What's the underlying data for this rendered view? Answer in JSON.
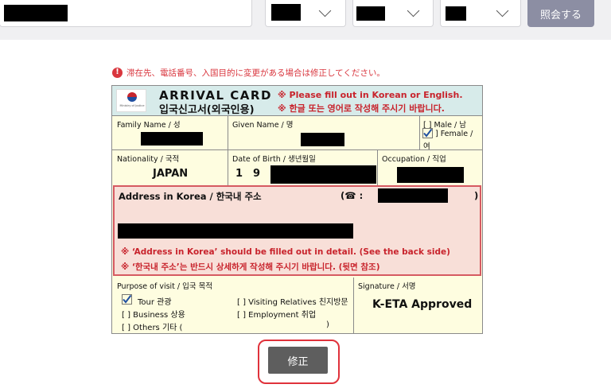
{
  "topbar": {
    "inquiry_button": "照会する"
  },
  "notice": {
    "icon": "exclamation-circle-icon",
    "text": "滞在先、電話番号、入国目的に変更がある場合は修正してください。"
  },
  "card": {
    "logo_caption": "Ministry of Justice",
    "title_en": "ARRIVAL CARD",
    "title_ko": "입국신고서(외국인용)",
    "header_note_en": "※ Please fill out in Korean or English.",
    "header_note_ko": "※ 한글 또는 영어로 작성해 주시기 바랍니다.",
    "family_name_label": "Family Name / 성",
    "given_name_label": "Given Name / 명",
    "sex_male": "[ ] Male / 남",
    "sex_female": "] Female /",
    "sex_female_ko": "여",
    "nationality_label": "Nationality / 국적",
    "nationality_value": "JAPAN",
    "dob_label": "Date of Birth / 생년월일",
    "dob_digits": [
      "1",
      "9"
    ],
    "occupation_label": "Occupation / 직업",
    "address_label": "Address in Korea / 한국내 주소",
    "phone_label": "(☎ :",
    "phone_close": ")",
    "address_note_en": "※ ‘Address in Korea’ should be filled out in detail. (See the back side)",
    "address_note_ko": "※ ‘한국내 주소’는 반드시 상세하게 작성해 주시기 바랍니다. (뒷면 참조)",
    "purpose_label": "Purpose of visit / 입국 목적",
    "purpose_options": {
      "tour": "Tour 관광",
      "business": "[ ] Business 상용",
      "others": "[ ] Others 기타 (",
      "others_close": ")",
      "visiting": "[ ] Visiting Relatives 친지방문",
      "employment": "[ ] Employment 취업"
    },
    "signature_label": "Signature / 서명",
    "signature_value": "K-ETA Approved"
  },
  "fix_button": "修正",
  "colors": {
    "notice_red": "#d9363e",
    "card_bg": "#fefde0",
    "header_bg": "#d7ebea",
    "address_bg": "#f8dfd8",
    "inquiry_button_bg": "#8c8ea3",
    "fix_button_bg": "#5e5e5e"
  }
}
